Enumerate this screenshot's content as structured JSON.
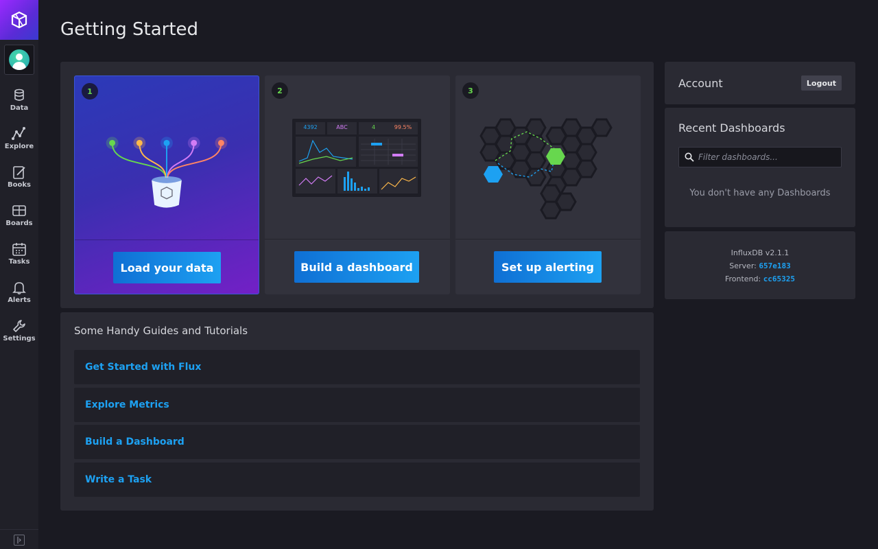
{
  "sidebar": {
    "items": [
      {
        "label": "Data"
      },
      {
        "label": "Explore"
      },
      {
        "label": "Books"
      },
      {
        "label": "Boards"
      },
      {
        "label": "Tasks"
      },
      {
        "label": "Alerts"
      },
      {
        "label": "Settings"
      }
    ]
  },
  "header": {
    "title": "Getting Started"
  },
  "getting_started": {
    "cards": [
      {
        "number": "1",
        "button": "Load your data"
      },
      {
        "number": "2",
        "button": "Build a dashboard"
      },
      {
        "number": "3",
        "button": "Set up alerting"
      }
    ],
    "dashboard_art": {
      "stats": [
        "4392",
        "ABC",
        "4",
        "99.5%"
      ]
    }
  },
  "guides": {
    "title": "Some Handy Guides and Tutorials",
    "links": [
      {
        "label": "Get Started with Flux"
      },
      {
        "label": "Explore Metrics"
      },
      {
        "label": "Build a Dashboard"
      },
      {
        "label": "Write a Task"
      }
    ]
  },
  "account": {
    "title": "Account",
    "logout_label": "Logout"
  },
  "recent_dashboards": {
    "title": "Recent Dashboards",
    "filter_placeholder": "Filter dashboards...",
    "empty_message": "You don't have any Dashboards"
  },
  "version": {
    "product": "InfluxDB v2.1.1",
    "server_label": "Server:",
    "server_hash": "657e183",
    "frontend_label": "Frontend:",
    "frontend_hash": "cc65325"
  },
  "colors": {
    "accent": "#1da1f2",
    "step_number": "#67d74e",
    "background": "#1a1a22"
  }
}
